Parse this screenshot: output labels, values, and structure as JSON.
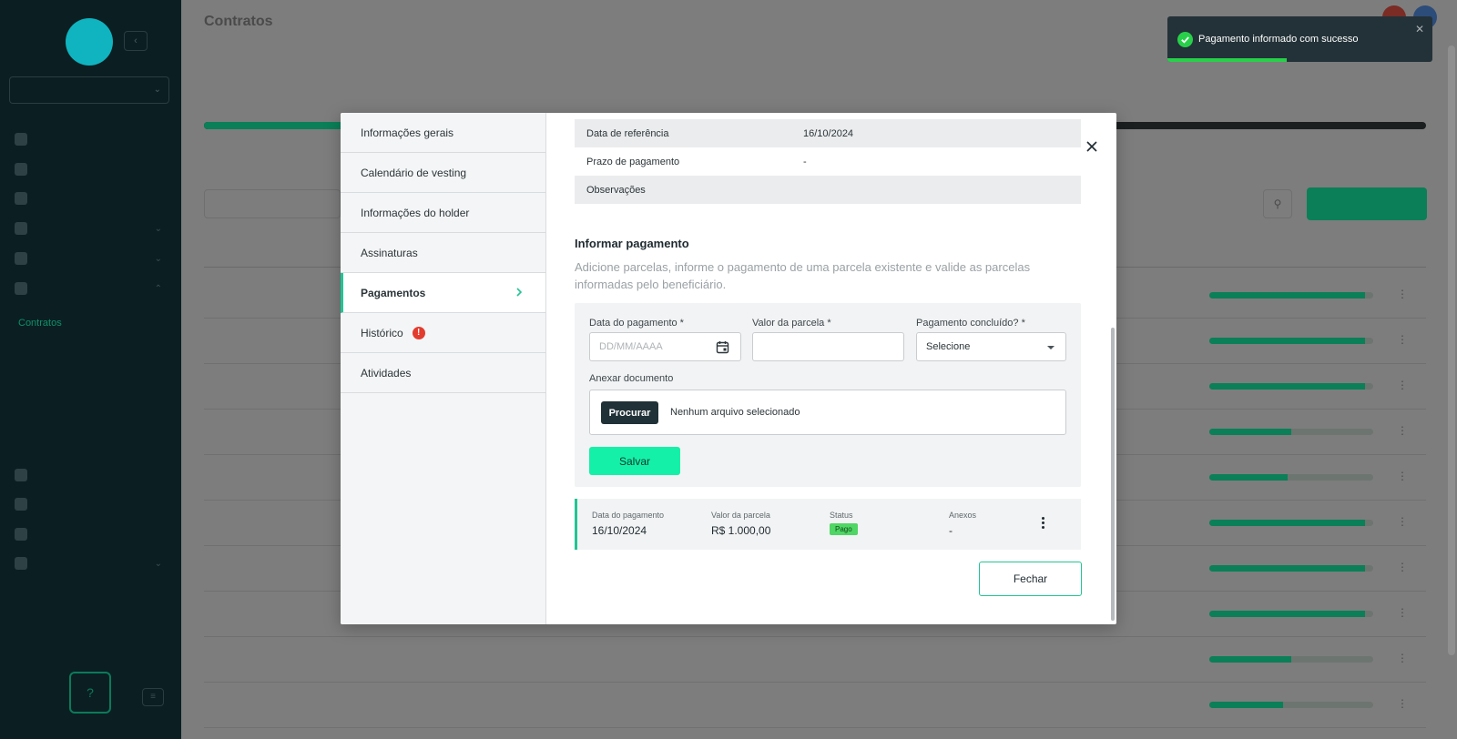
{
  "background": {
    "sidebar": {
      "logo_text": "",
      "company_select": "",
      "nav": [
        {
          "label": "",
          "icon": "home-icon"
        },
        {
          "label": "",
          "icon": "dashboard-icon"
        },
        {
          "label": "",
          "icon": "cap-table-icon"
        },
        {
          "label": "",
          "icon": "shareholders-icon"
        },
        {
          "label": "",
          "icon": "shares-icon"
        },
        {
          "label": "",
          "icon": "equity-icon"
        }
      ],
      "sub_nav": [
        "Contratos",
        "",
        "",
        "",
        ""
      ],
      "nav_bottom": [
        {
          "label": "",
          "icon": "stakeholders-icon"
        },
        {
          "label": "",
          "icon": "reports-icon"
        },
        {
          "label": "",
          "icon": "documents-icon"
        },
        {
          "label": "",
          "icon": "settings-icon"
        }
      ]
    },
    "page_title": "Contratos",
    "breadcrumb": "",
    "tabs": [
      "",
      "",
      ""
    ],
    "total_text": "",
    "search_label": "",
    "search_placeholder": "",
    "new_button": "",
    "table_headers": [
      "",
      "",
      ""
    ],
    "rows": [
      {
        "progress": 0.95
      },
      {
        "progress": 0.95
      },
      {
        "progress": 0.95
      },
      {
        "progress": 0.5
      },
      {
        "progress": 0.48
      },
      {
        "progress": 0.95
      },
      {
        "progress": 0.95
      },
      {
        "progress": 0.95
      },
      {
        "progress": 0.5
      },
      {
        "progress": 0.45
      }
    ]
  },
  "modal": {
    "nav": [
      {
        "label": "Informações gerais",
        "active": false
      },
      {
        "label": "Calendário de vesting",
        "active": false
      },
      {
        "label": "Informações do holder",
        "active": false
      },
      {
        "label": "Assinaturas",
        "active": false
      },
      {
        "label": "Pagamentos",
        "active": true
      },
      {
        "label": "Histórico",
        "active": false,
        "alert": "!"
      },
      {
        "label": "Atividades",
        "active": false
      }
    ],
    "info": [
      {
        "key": "Data de referência",
        "value": "16/10/2024"
      },
      {
        "key": "Prazo de pagamento",
        "value": "-"
      },
      {
        "key": "Observações",
        "value": ""
      }
    ],
    "section_title": "Informar pagamento",
    "section_description": "Adicione parcelas, informe o pagamento de uma parcela existente e valide as parcelas informadas pelo beneficiário.",
    "form": {
      "date_label": "Data do pagamento *",
      "date_placeholder": "DD/MM/AAAA",
      "amount_label": "Valor da parcela *",
      "amount_value": "",
      "completed_label": "Pagamento concluído? *",
      "completed_value": "Selecione",
      "attach_label": "Anexar documento",
      "browse_button": "Procurar",
      "file_status": "Nenhum arquivo selecionado",
      "save_button": "Salvar"
    },
    "payment": {
      "date_header": "Data do pagamento",
      "date_value": "16/10/2024",
      "amount_header": "Valor da parcela",
      "amount_value": "R$ 1.000,00",
      "status_header": "Status",
      "status_value": "Pago",
      "attachments_header": "Anexos",
      "attachments_value": "-"
    },
    "close_button": "Fechar"
  },
  "toast": {
    "message": "Pagamento informado com sucesso",
    "progress": 0.45,
    "icon": "check-circle-icon",
    "close_icon": "close-icon"
  },
  "colors": {
    "accent": "#22c493",
    "save_button": "#15f0a8",
    "dark": "#203137",
    "toast_bg": "#233238",
    "alert": "#e23c2e"
  }
}
